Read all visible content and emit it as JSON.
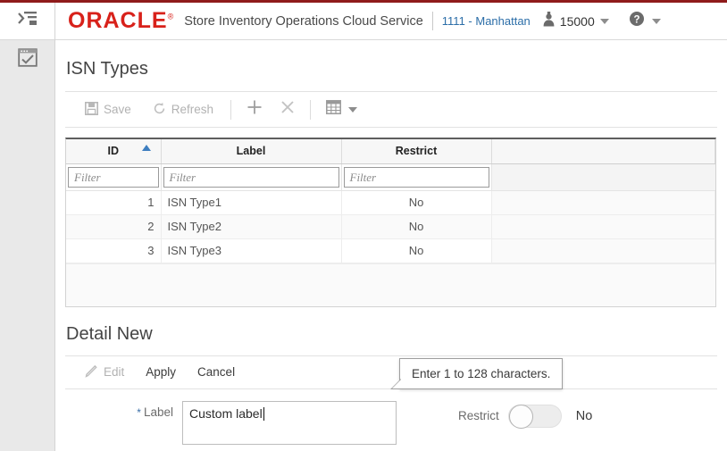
{
  "header": {
    "logo": "ORACLE",
    "logo_mark": "®",
    "app_title": "Store Inventory Operations Cloud Service",
    "store": "1111 - Manhattan",
    "user_id": "15000",
    "user_icon": "user-icon",
    "help_icon": "help-icon",
    "user_caret_icon": "chevron-down-icon",
    "help_caret_icon": "chevron-down-icon"
  },
  "rail": {
    "menu_icon": "menu-collapse-icon",
    "tasks_icon": "task-window-icon"
  },
  "page": {
    "title": "ISN Types",
    "toolbar": {
      "save_label": "Save",
      "save_icon": "save-disk-icon",
      "refresh_label": "Refresh",
      "refresh_icon": "refresh-icon",
      "add_icon": "plus-icon",
      "delete_icon": "close-x-icon",
      "view_icon": "grid-view-icon",
      "view_caret_icon": "chevron-down-icon"
    },
    "table": {
      "columns": [
        "ID",
        "Label",
        "Restrict",
        ""
      ],
      "sort_column": "ID",
      "sort_direction": "ascending",
      "filter_placeholder": "Filter",
      "filters": [
        "",
        "",
        ""
      ],
      "rows": [
        {
          "id": "1",
          "label": "ISN Type1",
          "restrict": "No"
        },
        {
          "id": "2",
          "label": "ISN Type2",
          "restrict": "No"
        },
        {
          "id": "3",
          "label": "ISN Type3",
          "restrict": "No"
        }
      ]
    }
  },
  "detail": {
    "title": "Detail New",
    "toolbar": {
      "edit_label": "Edit",
      "edit_icon": "pencil-icon",
      "apply_label": "Apply",
      "cancel_label": "Cancel"
    },
    "form": {
      "label_required_mark": "*",
      "label_caption": "Label",
      "label_value": "Custom label",
      "restrict_caption": "Restrict",
      "restrict_value": "No",
      "restrict_state": "off"
    },
    "tooltip": "Enter 1 to 128 characters."
  },
  "colors": {
    "oracle_red": "#d8211a",
    "top_border": "#8f1b1b",
    "link_blue": "#2c6ea8",
    "sort_blue": "#3e7ec0"
  }
}
